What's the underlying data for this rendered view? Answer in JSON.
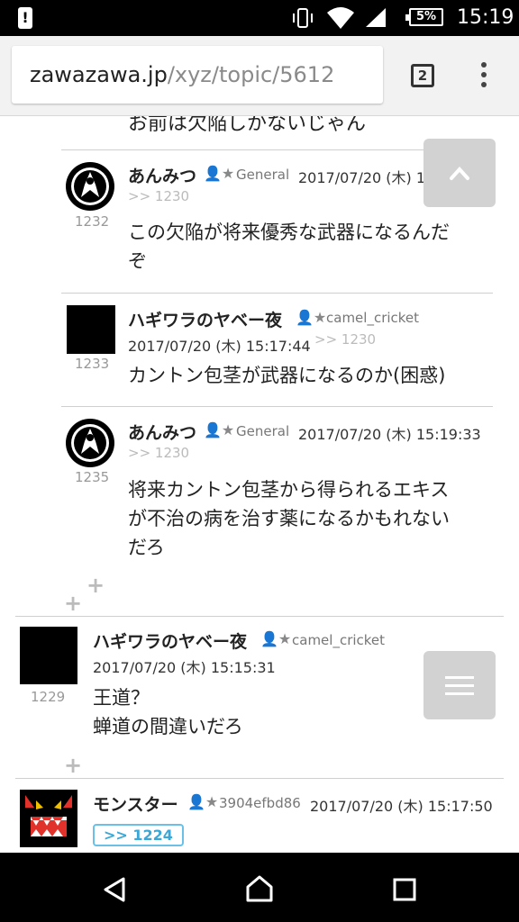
{
  "status_bar": {
    "battery": "5%",
    "time": "15:19",
    "icons": [
      "alert-icon",
      "vibrate-icon",
      "wifi-icon",
      "signal-icon",
      "battery-icon"
    ]
  },
  "browser": {
    "url_host": "zawazawa.jp",
    "url_path": "/xyz/topic/5612",
    "tab_count": "2"
  },
  "cut_text": "お前は欠陥しかないじゃん",
  "posts": [
    {
      "name": "あんみつ",
      "user_icon": "👤★",
      "user_id": "General",
      "date": "2017/07/20 (木) 15:17:13",
      "reply": ">> 1230",
      "num": "1232",
      "body_lines": [
        "この欠陥が将来優秀な武器になるんだ",
        "ぞ"
      ]
    },
    {
      "name": "ハギワラのヤベー夜",
      "user_icon": "👤★",
      "user_id": "camel_cricket",
      "date": "2017/07/20 (木) 15:17:44",
      "reply": ">> 1230",
      "num": "1233",
      "body_lines": [
        "カントン包茎が武器になるのか(困惑)"
      ]
    },
    {
      "name": "あんみつ",
      "user_icon": "👤★",
      "user_id": "General",
      "date": "2017/07/20 (木) 15:19:33",
      "reply": ">> 1230",
      "num": "1235",
      "body_lines": [
        "将来カントン包茎から得られるエキス",
        "が不治の病を治す薬になるかもれない",
        "だろ"
      ]
    },
    {
      "name": "ハギワラのヤベー夜",
      "user_icon": "👤★",
      "user_id": "camel_cricket",
      "date": "2017/07/20 (木) 15:15:31",
      "num": "1229",
      "body_lines": [
        "王道？",
        "蝉道の間違いだろ"
      ]
    },
    {
      "name": "モンスター",
      "user_icon": "👤★",
      "user_id": "3904efbd86",
      "date": "2017/07/20 (木) 15:17:50",
      "reply": ">> 1224"
    }
  ],
  "plus_symbol": "+",
  "colors": {
    "reply_link": "#3ba7d6",
    "float_button": "#d2d2d2"
  }
}
